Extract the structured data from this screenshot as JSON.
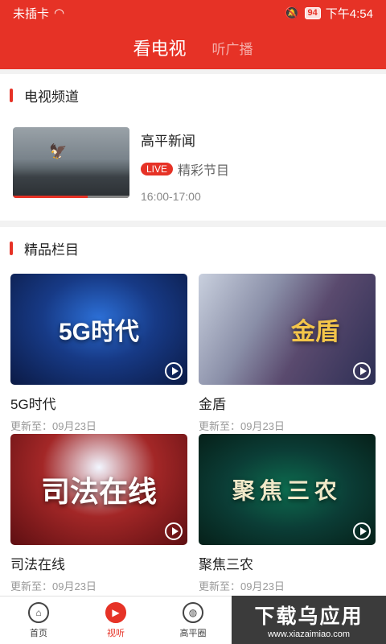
{
  "status_bar": {
    "left": "未插卡",
    "battery": "94",
    "time": "下午4:54"
  },
  "tabs": [
    "看电视",
    "听广播"
  ],
  "tv_section": {
    "title": "电视频道",
    "channel": {
      "name": "高平新闻",
      "live_badge": "LIVE",
      "program": "精彩节目",
      "time": "16:00-17:00",
      "progress_fraction": 0.64
    }
  },
  "featured_section": {
    "title": "精品栏目",
    "items": [
      {
        "name": "5G时代",
        "cover_text": "5G时代",
        "date": "更新至：09月23日"
      },
      {
        "name": "金盾",
        "cover_text": "金盾",
        "date": "更新至：09月23日"
      },
      {
        "name": "司法在线",
        "cover_text": "司法在线",
        "date": "更新至：09月23日"
      },
      {
        "name": "聚焦三农",
        "cover_text": "聚焦三农",
        "date": "更新至：09月23日"
      }
    ]
  },
  "bottom_nav": [
    {
      "label": "首页",
      "icon": "home-icon"
    },
    {
      "label": "视听",
      "icon": "tv-icon"
    },
    {
      "label": "高平圈",
      "icon": "planet-icon"
    }
  ],
  "watermark": {
    "main": "下载乌应用",
    "sub": "www.xiazaimiao.com"
  }
}
